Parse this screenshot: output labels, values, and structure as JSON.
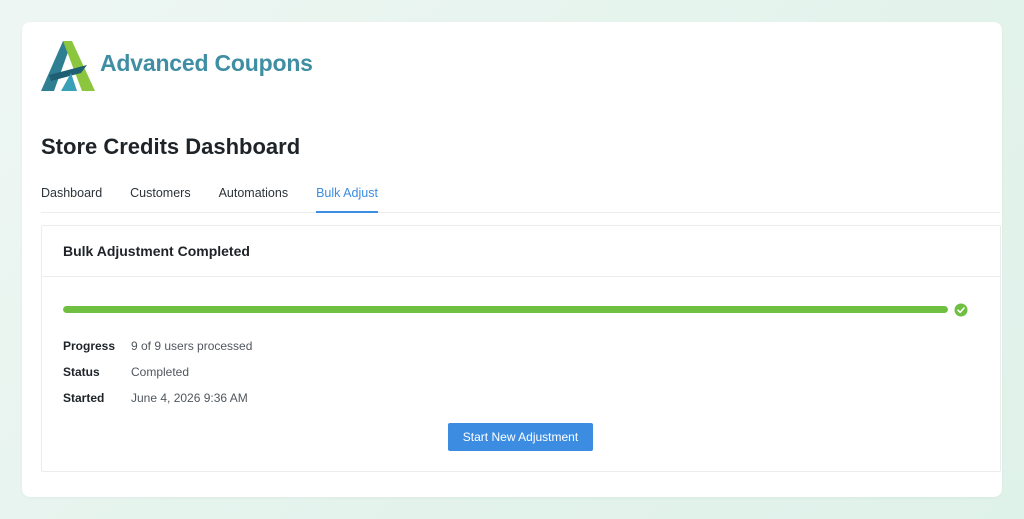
{
  "brand": {
    "name": "Advanced Coupons",
    "logo_icon": "advanced-coupons-logo-icon"
  },
  "page": {
    "title": "Store Credits Dashboard"
  },
  "tabs": [
    {
      "label": "Dashboard",
      "active": false
    },
    {
      "label": "Customers",
      "active": false
    },
    {
      "label": "Automations",
      "active": false
    },
    {
      "label": "Bulk Adjust",
      "active": true
    }
  ],
  "panel": {
    "title": "Bulk Adjustment Completed",
    "progress_fraction": 1.0,
    "status_icon": "check-circle-icon",
    "details": [
      {
        "label": "Progress",
        "value": "9 of 9 users processed"
      },
      {
        "label": "Status",
        "value": "Completed"
      },
      {
        "label": "Started",
        "value": "June 4, 2026 9:36 AM"
      }
    ],
    "button_label": "Start New Adjustment"
  },
  "colors": {
    "accent": "#3c8de2",
    "success": "#6fbf40",
    "brand_text": "#3f8ea4"
  }
}
